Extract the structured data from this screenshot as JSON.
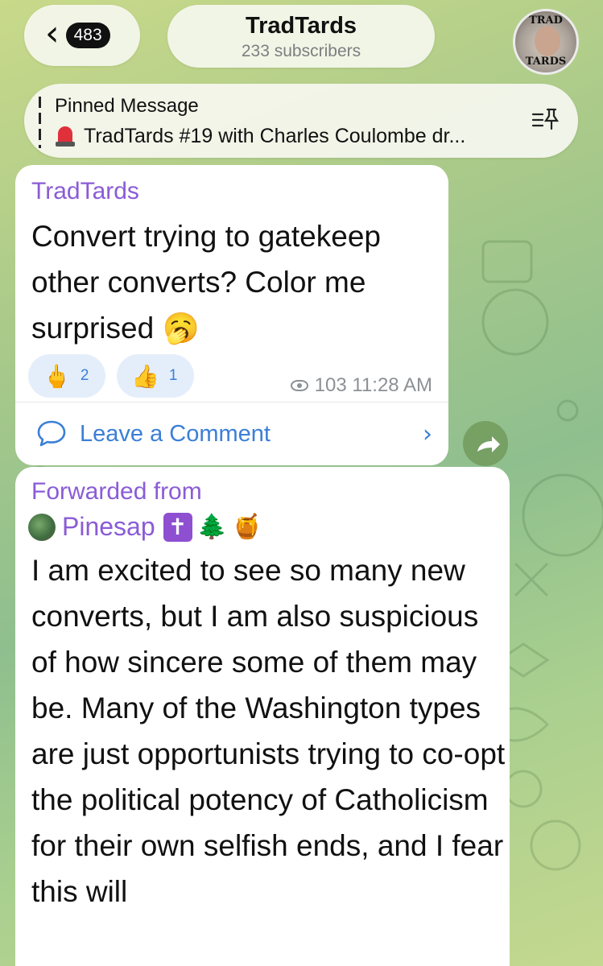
{
  "header": {
    "back_count": "483",
    "channel_name": "TradTards",
    "subscribers": "233 subscribers",
    "avatar_text_top": "TRAD",
    "avatar_text_bottom": "TARDS"
  },
  "pinned": {
    "title": "Pinned Message",
    "text": "TradTards #19 with Charles Coulombe dr..."
  },
  "messages": [
    {
      "sender": "TradTards",
      "text": "Convert trying to gatekeep other converts? Color me surprised 🥱",
      "reactions": [
        {
          "emoji": "🖕",
          "count": "2"
        },
        {
          "emoji": "👍",
          "count": "1"
        }
      ],
      "views": "103",
      "time": "11:28 AM",
      "comment_label": "Leave a Comment"
    },
    {
      "forwarded_label": "Forwarded from",
      "source_name": "Pinesap",
      "source_emojis": [
        "✝",
        "🌲",
        "🍯"
      ],
      "text": "I am excited to see so many new converts, but I am also suspicious of how sincere some of them may be. Many of the Washington types are just opportunists trying to co-opt the political potency of Catholicism for their own selfish ends, and I fear this will"
    }
  ],
  "colors": {
    "accent_purple": "#8a5cd6",
    "link_blue": "#3b7fd6",
    "reaction_bg": "#e4eefb"
  },
  "icons": [
    "chevron-left-icon",
    "siren-icon",
    "pinned-list-icon",
    "eye-icon",
    "comment-bubble-icon",
    "chevron-right-icon",
    "share-arrow-icon"
  ]
}
